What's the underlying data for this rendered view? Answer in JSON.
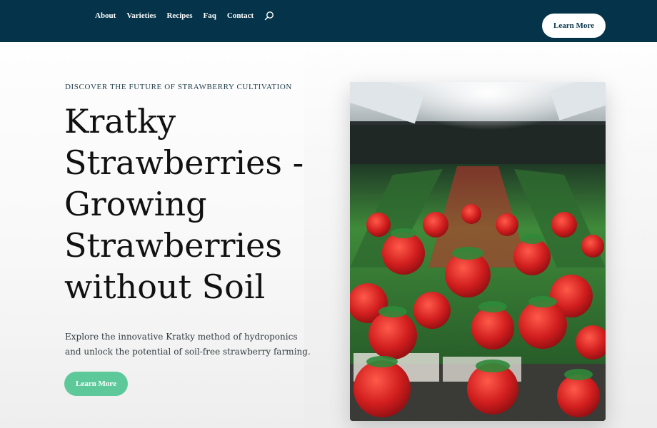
{
  "nav": {
    "links": [
      "About",
      "Varieties",
      "Recipes",
      "Faq",
      "Contact"
    ],
    "search_icon": "search-icon",
    "cta_label": "Learn More"
  },
  "hero": {
    "eyebrow": "DISCOVER THE FUTURE OF STRAWBERRY CULTIVATION",
    "title": "Kratky Strawberries - Growing Strawberries without Soil",
    "subtitle": "Explore the innovative Kratky method of hydroponics and unlock the potential of soil-free strawberry farming.",
    "cta_label": "Learn More"
  },
  "colors": {
    "nav_bg": "#05344a",
    "accent_green": "#5dc99a",
    "strawberry_red": "#d42a2a",
    "leaf_green": "#2f8a3a"
  }
}
